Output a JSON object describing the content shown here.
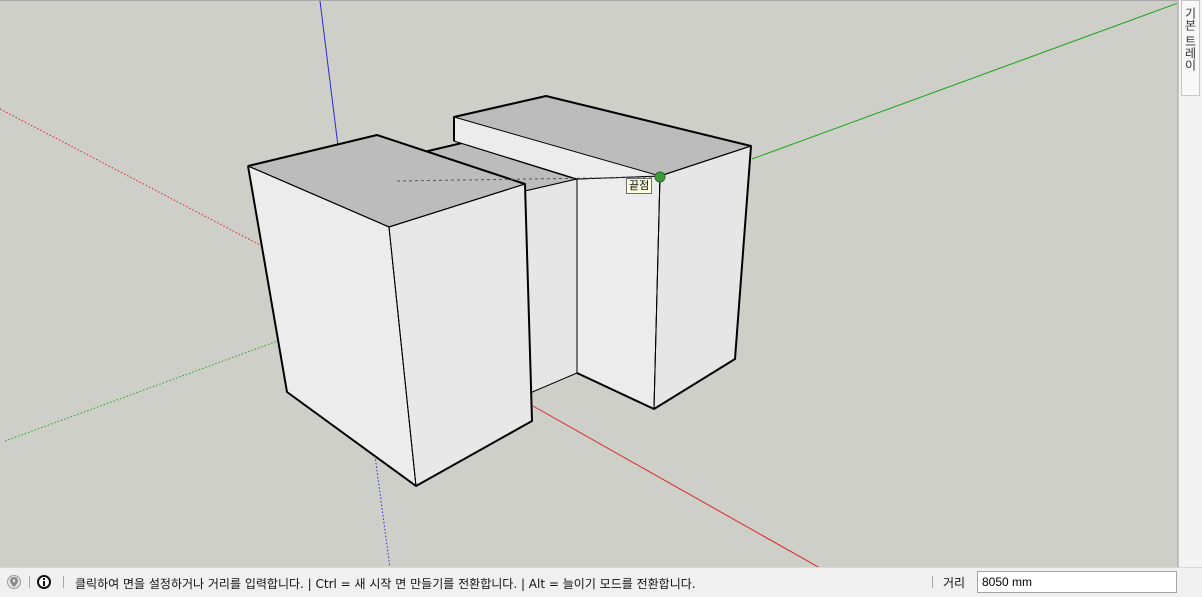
{
  "tray": {
    "title": "기본 트레이"
  },
  "viewport": {
    "inference_tooltip": "끝점",
    "axis_colors": {
      "red": "#d62828",
      "green": "#1fa51f",
      "blue": "#2a2ad6"
    },
    "endpoint_color": "#3d9a3d",
    "face_colors": {
      "top": "#bcbcbc",
      "front": "#ececec",
      "side": "#e6e6e6"
    }
  },
  "statusbar": {
    "geo_icon": "location-pin-icon",
    "info_icon": "info-icon",
    "message": "클릭하여 면을 설정하거나 거리를 입력합니다. | Ctrl = 새 시작 면 만들기를 전환합니다. | Alt = 늘이기 모드를 전환합니다.",
    "measurement_label": "거리",
    "measurement_value": "8050 mm"
  }
}
